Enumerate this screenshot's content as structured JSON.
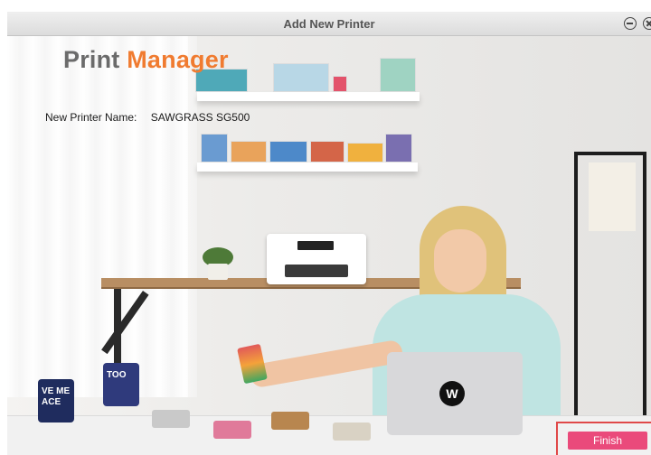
{
  "window": {
    "title": "Add New Printer",
    "minimize_icon": "minimize-circle-icon",
    "close_icon": "close-circle-icon"
  },
  "app": {
    "logo_part1": "Print",
    "logo_part2": "Manager",
    "colors": {
      "logo_gray": "#6b6b6b",
      "logo_orange": "#f07b30",
      "finish_button": "#ea4a7b",
      "highlight": "#e04848"
    }
  },
  "printer_name": {
    "label": "New Printer Name:",
    "value": "SAWGRASS SG500"
  },
  "actions": {
    "finish_label": "Finish"
  },
  "background_art": {
    "laptop_logo": "W",
    "mug1_text": "VE ME\nACE",
    "mug2_text": "TOO"
  }
}
